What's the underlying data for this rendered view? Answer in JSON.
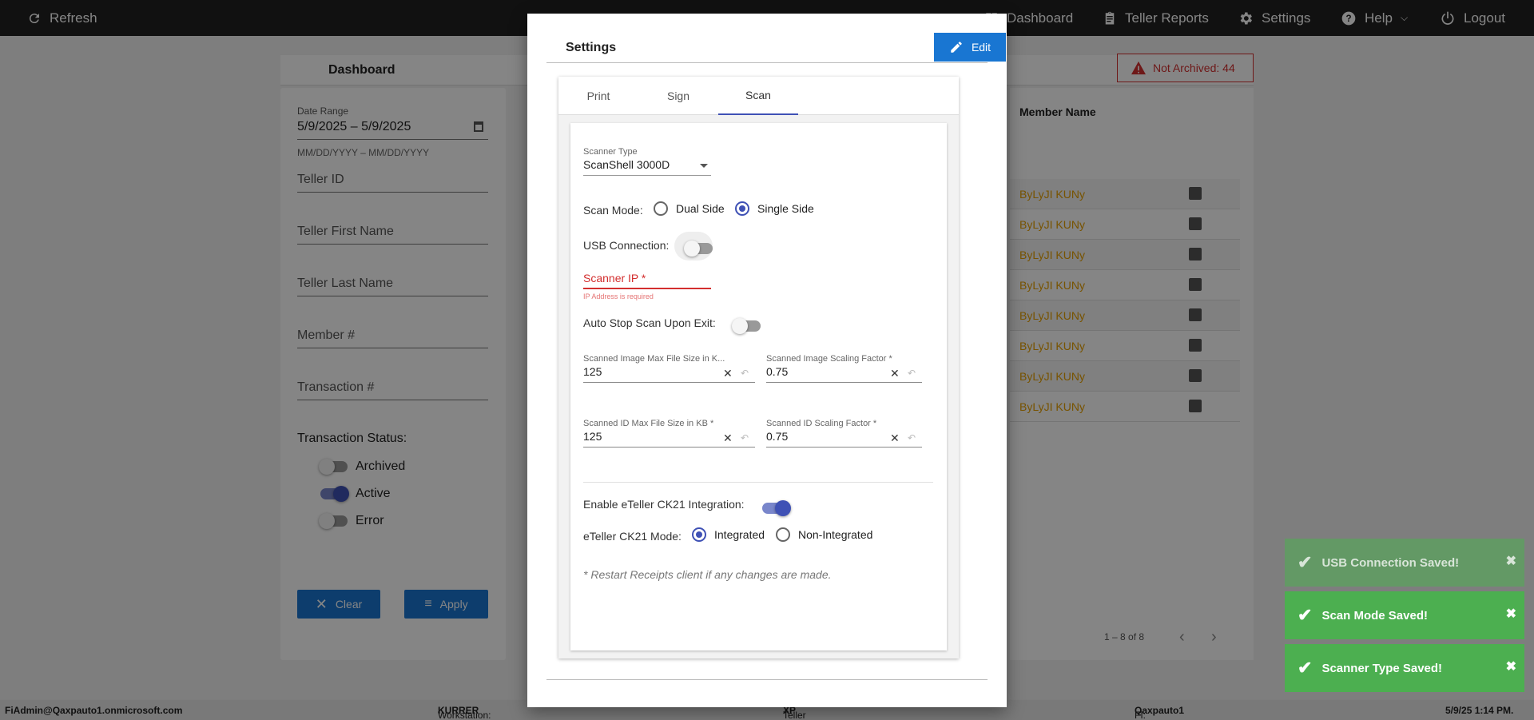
{
  "topbar": {
    "refresh": "Refresh",
    "dashboard": "Dashboard",
    "teller_reports": "Teller Reports",
    "settings": "Settings",
    "help": "Help",
    "logout": "Logout"
  },
  "dashboard": {
    "title": "Dashboard",
    "not_archived": "Not Archived: 44",
    "filters": {
      "date_range_label": "Date Range",
      "date_range_value": "5/9/2025 – 5/9/2025",
      "date_hint": "MM/DD/YYYY – MM/DD/YYYY",
      "teller_id": "Teller ID",
      "teller_first_name": "Teller First Name",
      "teller_last_name": "Teller Last Name",
      "member_no": "Member #",
      "transaction_no": "Transaction #",
      "status_label": "Transaction Status:",
      "archived": "Archived",
      "active": "Active",
      "error": "Error",
      "clear": "Clear",
      "apply": "Apply"
    },
    "table": {
      "header": "Member Name",
      "rows": [
        "ByLyJI KUNy",
        "ByLyJI KUNy",
        "ByLyJI KUNy",
        "ByLyJI KUNy",
        "ByLyJI KUNy",
        "ByLyJI KUNy",
        "ByLyJI KUNy",
        "ByLyJI KUNy"
      ],
      "pager": "1 – 8 of 8"
    }
  },
  "modal": {
    "title": "Settings",
    "edit": "Edit",
    "tabs": [
      "Print",
      "Sign",
      "Scan"
    ],
    "active_tab": "Scan",
    "scanner_type_label": "Scanner Type",
    "scanner_type_value": "ScanShell 3000D",
    "scan_mode_label": "Scan Mode:",
    "scan_mode_options": [
      "Dual Side",
      "Single Side"
    ],
    "scan_mode_selected": "Single Side",
    "usb_label": "USB Connection:",
    "usb_on": false,
    "scanner_ip_placeholder": "Scanner IP *",
    "scanner_ip_error": "IP Address is required",
    "auto_stop_label": "Auto Stop Scan Upon Exit:",
    "auto_stop_on": false,
    "img_max_label": "Scanned Image Max File Size in K...",
    "img_max_value": "125",
    "img_scale_label": "Scanned Image Scaling Factor *",
    "img_scale_value": "0.75",
    "id_max_label": "Scanned ID Max File Size in KB *",
    "id_max_value": "125",
    "id_scale_label": "Scanned ID Scaling Factor *",
    "id_scale_value": "0.75",
    "ck21_label": "Enable eTeller CK21 Integration:",
    "ck21_on": true,
    "ck21_mode_label": "eTeller CK21 Mode:",
    "ck21_mode_options": [
      "Integrated",
      "Non-Integrated"
    ],
    "ck21_mode_selected": "Integrated",
    "note": "* Restart Receipts client if any changes are made."
  },
  "toasts": [
    {
      "text": "USB Connection Saved!",
      "faded": true
    },
    {
      "text": "Scan Mode Saved!",
      "faded": false
    },
    {
      "text": "Scanner Type Saved!",
      "faded": false
    }
  ],
  "status_bar": {
    "user": "FiAdmin@Qaxpauto1.onmicrosoft.com",
    "workstation_label": "Workstation: ",
    "workstation": "KURRER",
    "platform_label": "Teller Platform: ",
    "platform": "XP",
    "fi_label": "FI: ",
    "fi": "Qaxpauto1",
    "datetime": "5/9/25 1:14 PM."
  },
  "colors": {
    "primary": "#1976d2",
    "accent": "#3f51b5",
    "error": "#d32f2f",
    "toast_green": "#4caf50",
    "member_link": "#e6a000"
  }
}
